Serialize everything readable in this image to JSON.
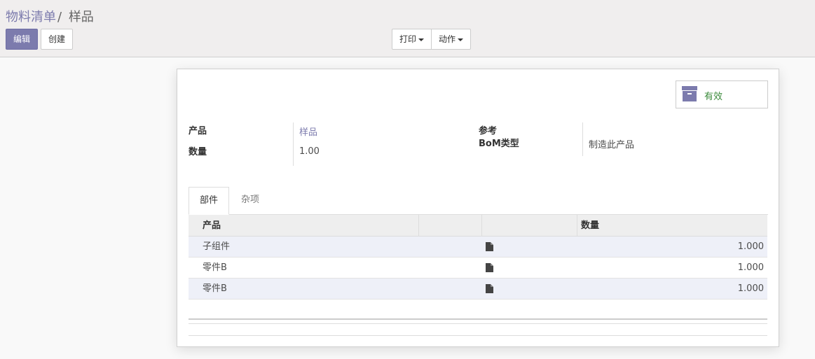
{
  "breadcrumb": {
    "parent": "物料清单",
    "separator": "/",
    "current": "样品"
  },
  "toolbar": {
    "edit_label": "编辑",
    "create_label": "创建",
    "print_label": "打印",
    "action_label": "动作"
  },
  "stat_button": {
    "label": "有效",
    "icon": "archive-icon"
  },
  "fields": {
    "product_label": "产品",
    "product_value": "样品",
    "quantity_label": "数量",
    "quantity_value": "1.00",
    "reference_label": "参考",
    "bom_type_label": "BoM类型",
    "bom_type_value": "制造此产品"
  },
  "tabs": [
    {
      "label": "部件",
      "active": true
    },
    {
      "label": "杂项",
      "active": false
    }
  ],
  "table": {
    "headers": {
      "product": "产品",
      "quantity": "数量"
    },
    "rows": [
      {
        "product": "子组件",
        "quantity": "1.000",
        "icon": "document-icon"
      },
      {
        "product": "零件B",
        "quantity": "1.000",
        "icon": "document-icon"
      },
      {
        "product": "零件B",
        "quantity": "1.000",
        "icon": "document-icon"
      }
    ]
  },
  "colors": {
    "primary": "#7c7bad",
    "link": "#7c7bad",
    "active_status": "#3a8a3a",
    "row_stripe": "#eef0f8"
  }
}
